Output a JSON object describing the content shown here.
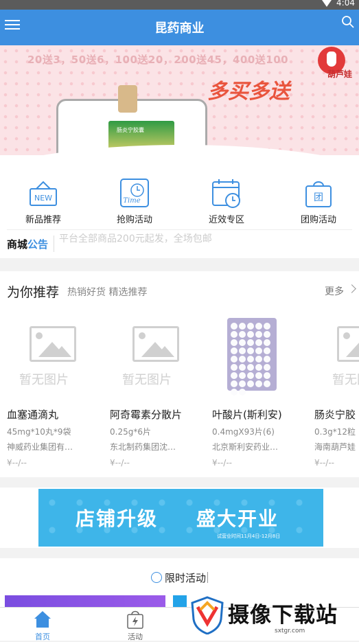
{
  "status_bar": {
    "time": "4:04"
  },
  "app_bar": {
    "title": "昆药商业"
  },
  "banner": {
    "promo_text": "20送3，50送6，100送20，200送45，400送100",
    "slogan": "多买多送",
    "brand": "葫芦娃",
    "box_label": "肠炎宁胶囊"
  },
  "quick_menu": [
    {
      "label": "新品推荐",
      "icon": "new-sign-icon"
    },
    {
      "label": "抢购活动",
      "icon": "time-clock-icon"
    },
    {
      "label": "近效专区",
      "icon": "calendar-clock-icon"
    },
    {
      "label": "团购活动",
      "icon": "shopping-bag-icon"
    }
  ],
  "notice": {
    "tag_prefix": "商城",
    "tag_suffix": "公告",
    "text": "平台全部商品200元起发，全场包邮"
  },
  "recommend": {
    "title": "为你推荐",
    "subtitle": "热销好货 精选推荐",
    "more": "更多",
    "placeholder_text": "暂无图片",
    "products": [
      {
        "name": "血塞通滴丸",
        "spec": "45mg*10丸*9袋",
        "maker": "神威药业集团有…",
        "price": "¥--/--",
        "image": "placeholder"
      },
      {
        "name": "阿奇霉素分散片",
        "spec": "0.25g*6片",
        "maker": "东北制药集团沈…",
        "price": "¥--/--",
        "image": "placeholder"
      },
      {
        "name": "叶酸片(斯利安)",
        "spec": "0.4mgX93片(6)",
        "maker": "北京斯利安药业…",
        "price": "¥--/--",
        "image": "pill-blister"
      },
      {
        "name": "肠炎宁胶",
        "spec": "0.3g*12粒",
        "maker": "海南葫芦娃",
        "price": "¥--/--",
        "image": "placeholder"
      }
    ]
  },
  "ad_banner": {
    "line1": "店铺升级",
    "line2": "盛大开业",
    "note": "试营业时间11月4日-12月8日"
  },
  "limited": {
    "title": "限时活动"
  },
  "tabs": [
    {
      "label": "首页",
      "icon": "home-icon",
      "active": true
    },
    {
      "label": "活动",
      "icon": "bag-lightning-icon",
      "active": false
    }
  ],
  "watermark": {
    "title": "摄像下载站",
    "subtitle": "sxtgr.com"
  },
  "colors": {
    "primary": "#3d8fe0",
    "banner_bg": "#fbe3e6",
    "ad_bg": "#3eb5e9"
  }
}
